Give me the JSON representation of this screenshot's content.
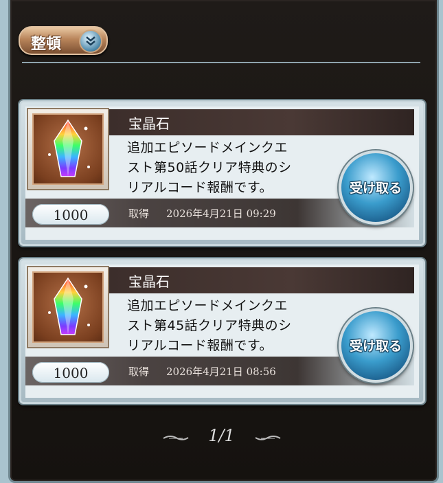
{
  "toolbar": {
    "sort_label": "整頓"
  },
  "items": [
    {
      "title": "宝晶石",
      "description_lines": [
        "追加エピソードメインクエ",
        "スト第50話クリア特典のシ",
        "リアルコード報酬です。"
      ],
      "quantity": "1000",
      "acquired_label": "取得",
      "acquired_date": "2026年4月21日 09:29",
      "receive_label": "受け取る"
    },
    {
      "title": "宝晶石",
      "description_lines": [
        "追加エピソードメインクエ",
        "スト第45話クリア特典のシ",
        "リアルコード報酬です。"
      ],
      "quantity": "1000",
      "acquired_label": "取得",
      "acquired_date": "2026年4月21日 08:56",
      "receive_label": "受け取る"
    }
  ],
  "pagination": {
    "text": "1/1"
  },
  "icons": {
    "sort": "chevron-down-double-icon",
    "item": "crystal-icon",
    "ornaments": "flourish-icon"
  },
  "colors": {
    "accent_blue": "#3a9ccc",
    "sort_button": "#b8845a",
    "panel_bg": "#1f1b18"
  }
}
